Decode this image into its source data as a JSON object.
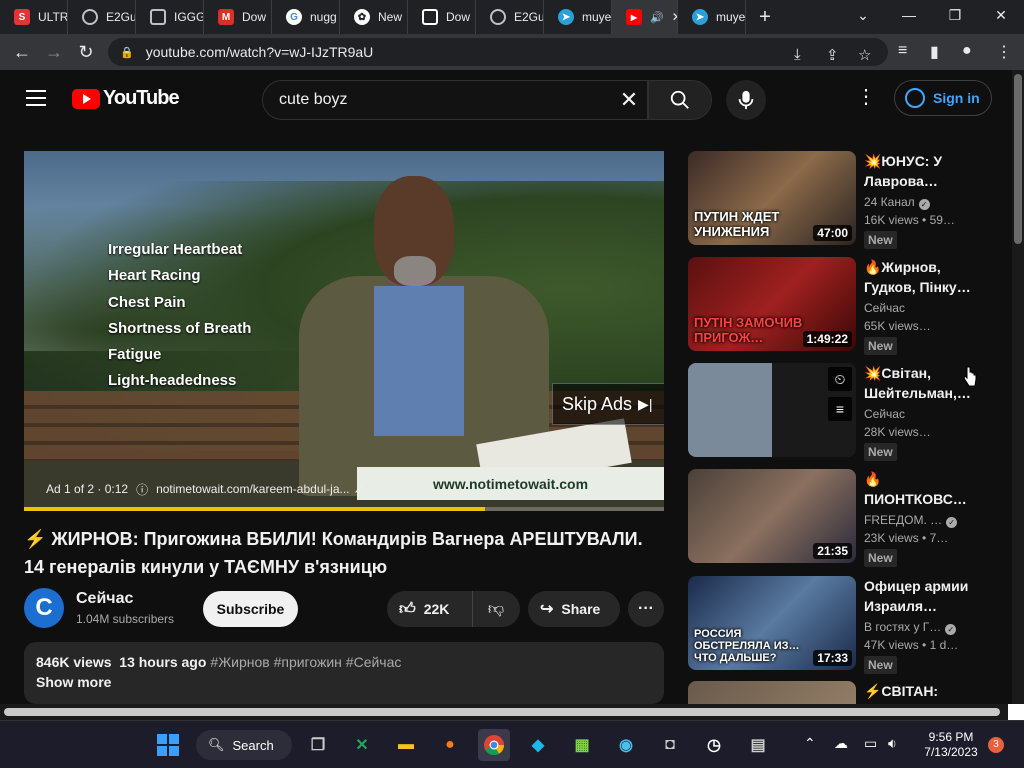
{
  "browser": {
    "tabs": [
      {
        "label": "ULTR",
        "icon": "scribd-icon",
        "color": "#e23434"
      },
      {
        "label": "E2Gu",
        "icon": "globe-icon",
        "color": "#5f6368"
      },
      {
        "label": "IGGG",
        "icon": "iggg-icon",
        "color": "#5f6368"
      },
      {
        "label": "Dow",
        "icon": "gmail-icon",
        "color": "#d93025"
      },
      {
        "label": "nugg",
        "icon": "google-icon",
        "color": "#ffffff"
      },
      {
        "label": "New",
        "icon": "chatgpt-icon",
        "color": "#ffffff"
      },
      {
        "label": "Dow",
        "icon": "page-icon",
        "color": "#ffffff"
      },
      {
        "label": "E2Gu",
        "icon": "globe-icon",
        "color": "#5f6368"
      },
      {
        "label": "muye",
        "icon": "telegram-icon",
        "color": "#2aa0da"
      },
      {
        "label": "",
        "icon": "youtube-icon",
        "color": "#ff0000"
      },
      {
        "label": "muye",
        "icon": "telegram-icon",
        "color": "#2aa0da"
      }
    ],
    "url": "youtube.com/watch?v=wJ-IJzTR9aU"
  },
  "youtube": {
    "logo": "YouTube",
    "search_value": "cute boyz",
    "signin": "Sign in",
    "ad": {
      "symptoms": [
        "Irregular Heartbeat",
        "Heart Racing",
        "Chest Pain",
        "Shortness of Breath",
        "Fatigue",
        "Light-headedness"
      ],
      "skip_label": "Skip Ads",
      "counter": "Ad 1 of 2 · 0:12",
      "url": "notimetowait.com/kareem-abdul-ja...",
      "banner": "www.notimetowait.com",
      "progress": 0.72
    },
    "video": {
      "title": "⚡ ЖИРНОВ: Пригожина ВБИЛИ! Командирів Вагнера АРЕШТУВАЛИ. 14 генералів кинули у ТАЄМНУ в'язницю",
      "channel": "Сейчас",
      "channel_initial": "C",
      "subscribers": "1.04M subscribers",
      "subscribe": "Subscribe",
      "likes": "22K",
      "share": "Share",
      "views": "846K views",
      "age": "13 hours ago",
      "tags": "#Жирнов #пригожин #Сейчас",
      "show_more": "Show more"
    },
    "recommendations": [
      {
        "title": "💥ЮНУС: У Лаврова…",
        "channel": "24 Канал",
        "verified": true,
        "views": "16K views",
        "extra": "59…",
        "duration": "47:00",
        "badge": "New",
        "caption": "ПУТИН ЖДЕТ УНИЖЕНИЯ",
        "bg": "#3a2a26"
      },
      {
        "title": "🔥Жирнов, Гудков, Пінку…",
        "channel": "Сейчас",
        "verified": false,
        "views": "65K views…",
        "extra": "",
        "duration": "1:49:22",
        "badge": "New",
        "caption": "ПУТІН ЗАМОЧИВ ПРИГОЖ…",
        "bg": "#7a1212"
      },
      {
        "title": "💥Світан, Шейтельман,…",
        "channel": "Сейчас",
        "verified": false,
        "views": "28K views…",
        "extra": "",
        "duration": "",
        "badge": "New",
        "caption": "",
        "bg": "#4c5a68"
      },
      {
        "title": "🔥 ПИОНТКОВС…",
        "channel": "FREEДОМ. …",
        "verified": true,
        "views": "23K views",
        "extra": "7…",
        "duration": "21:35",
        "badge": "New",
        "caption": "",
        "bg": "#5a4a3c"
      },
      {
        "title": "Офицер армии Израиля…",
        "channel": "В гостях у Г…",
        "verified": true,
        "views": "47K views",
        "extra": "1 d…",
        "duration": "17:33",
        "badge": "New",
        "caption": "РОССИЯ ОБСТРЕЛЯЛА ИЗ… ЧТО ДАЛЬШЕ?",
        "bg": "#2a3a5a"
      },
      {
        "title": "⚡СВІТАН:",
        "channel": "",
        "verified": false,
        "views": "",
        "extra": "",
        "duration": "",
        "badge": "",
        "caption": "",
        "bg": "#6a5a4c"
      }
    ]
  },
  "taskbar": {
    "search": "Search",
    "time": "9:56 PM",
    "date": "7/13/2023",
    "notifications": "3"
  }
}
